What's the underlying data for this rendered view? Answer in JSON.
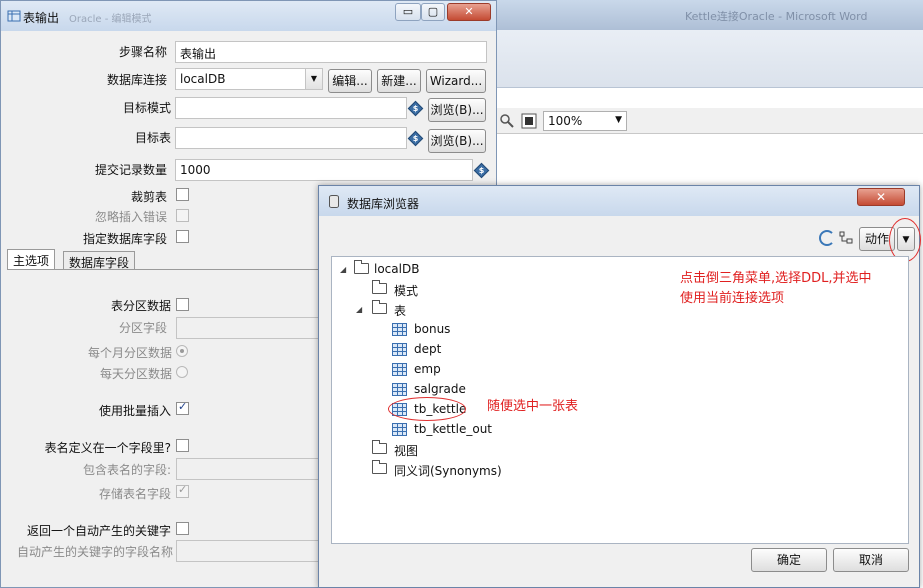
{
  "background_window": {
    "title": "Kettle连接Oracle - Microsoft Word",
    "zoom": "100%"
  },
  "table_output_dialog": {
    "title": "表输出",
    "title_sub": "Oracle - 编辑模式",
    "minimize": "▭",
    "maximize": "▢",
    "close": "✕",
    "step_name_label": "步骤名称",
    "step_name_value": "表输出",
    "connection_label": "数据库连接",
    "connection_value": "localDB",
    "edit_button": "编辑...",
    "new_button": "新建...",
    "wizard_button": "Wizard...",
    "target_schema_label": "目标模式",
    "target_schema_value": "",
    "browse_button_1": "浏览(B)...",
    "target_table_label": "目标表",
    "target_table_value": "",
    "browse_button_2": "浏览(B)...",
    "commit_size_label": "提交记录数量",
    "commit_size_value": "1000",
    "truncate_label": "裁剪表",
    "ignore_errors_label": "忽略插入错误",
    "specify_fields_label": "指定数据库字段",
    "tabs": [
      "主选项",
      "数据库字段"
    ],
    "partition_label": "表分区数据",
    "partition_field_label": "分区字段",
    "monthly_label": "每个月分区数据",
    "daily_label": "每天分区数据",
    "batch_insert_label": "使用批量插入",
    "batch_insert_checked": true,
    "table_in_field_label": "表名定义在一个字段里?",
    "field_contains_table_label": "包含表名的字段:",
    "store_table_name_label": "存储表名字段",
    "store_table_name_checked": true,
    "return_key_label": "返回一个自动产生的关键字",
    "return_key_field_label": "自动产生的关键字的字段名称"
  },
  "db_browser": {
    "title": "数据库浏览器",
    "close": "✕",
    "action_button": "动作",
    "tree": {
      "root": "localDB",
      "schemas": "模式",
      "tables_label": "表",
      "tables": [
        "bonus",
        "dept",
        "emp",
        "salgrade",
        "tb_kettle",
        "tb_kettle_out"
      ],
      "views": "视图",
      "synonyms": "同义词(Synonyms)"
    },
    "ok_button": "确定",
    "cancel_button": "取消",
    "annotation_menu": [
      "点击倒三角菜单,选择DDL,并选中",
      "使用当前连接选项"
    ],
    "annotation_select": "随便选中一张表"
  }
}
